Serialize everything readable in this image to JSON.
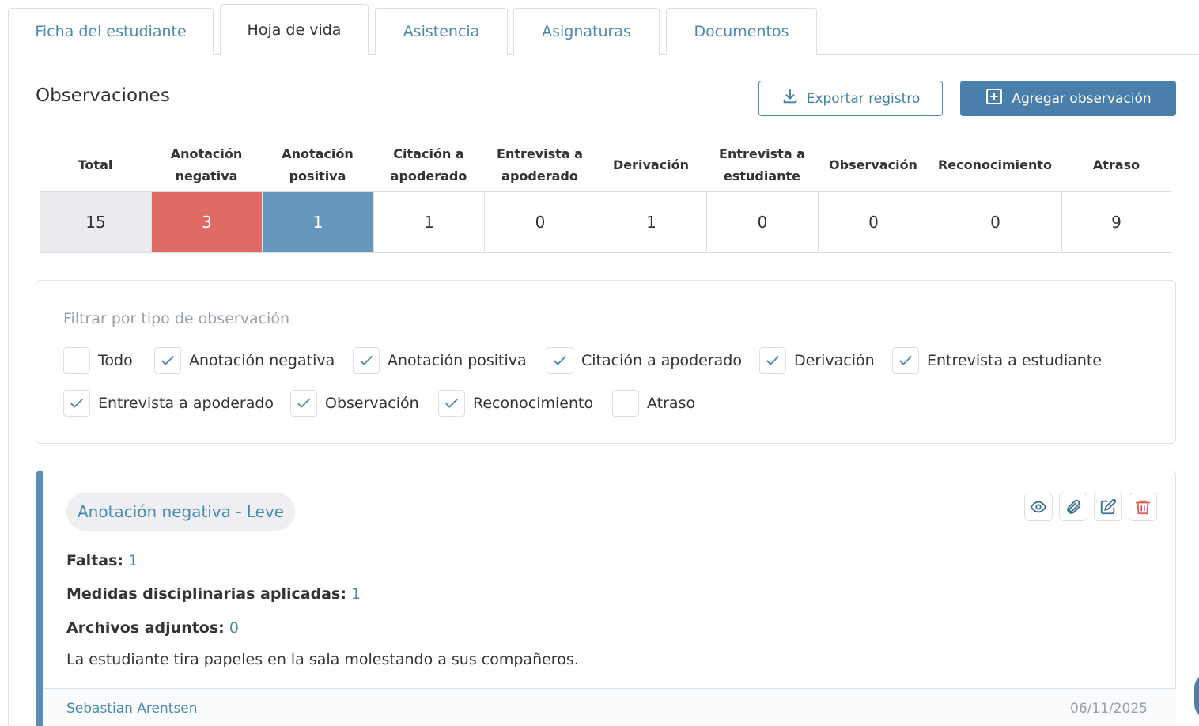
{
  "tabs": [
    {
      "label": "Ficha del estudiante"
    },
    {
      "label": "Hoja de vida"
    },
    {
      "label": "Asistencia"
    },
    {
      "label": "Asignaturas"
    },
    {
      "label": "Documentos"
    }
  ],
  "active_tab": "Hoja de vida",
  "section": {
    "title": "Observaciones",
    "export_label": "Exportar registro",
    "add_label": "Agregar observación"
  },
  "stats": {
    "headers": [
      "Total",
      "Anotación negativa",
      "Anotación positiva",
      "Citación a apoderado",
      "Entrevista a apoderado",
      "Derivación",
      "Entrevista a estudiante",
      "Observación",
      "Reconocimiento",
      "Atraso"
    ],
    "values": [
      "15",
      "3",
      "1",
      "1",
      "0",
      "1",
      "0",
      "0",
      "0",
      "9"
    ],
    "colors": {
      "total_bg": "#ececf0",
      "negative_bg": "#e06a64",
      "positive_bg": "#6698bd"
    }
  },
  "filter": {
    "label": "Filtrar por tipo de observación",
    "options": [
      {
        "label": "Todo",
        "checked": false
      },
      {
        "label": "Anotación negativa",
        "checked": true
      },
      {
        "label": "Anotación positiva",
        "checked": true
      },
      {
        "label": "Citación a apoderado",
        "checked": true
      },
      {
        "label": "Derivación",
        "checked": true
      },
      {
        "label": "Entrevista a estudiante",
        "checked": true
      },
      {
        "label": "Entrevista a apoderado",
        "checked": true
      },
      {
        "label": "Observación",
        "checked": true
      },
      {
        "label": "Reconocimiento",
        "checked": true
      },
      {
        "label": "Atraso",
        "checked": false
      }
    ]
  },
  "observation": {
    "badge": "Anotación negativa - Leve",
    "faltas_label": "Faltas:",
    "faltas_value": "1",
    "medidas_label": "Medidas disciplinarias aplicadas:",
    "medidas_value": "1",
    "archivos_label": "Archivos adjuntos:",
    "archivos_value": "0",
    "description": "La estudiante tira papeles en la sala molestando a sus compañeros.",
    "author": "Sebastian Arentsen",
    "date": "06/11/2025",
    "actions": [
      "eye-icon",
      "paperclip-icon",
      "edit-icon",
      "trash-icon"
    ]
  },
  "colors": {
    "accent": "#4a89b3",
    "primary_button": "#4a7fab",
    "left_bar": "#5a8db5",
    "danger": "#e05a55"
  }
}
